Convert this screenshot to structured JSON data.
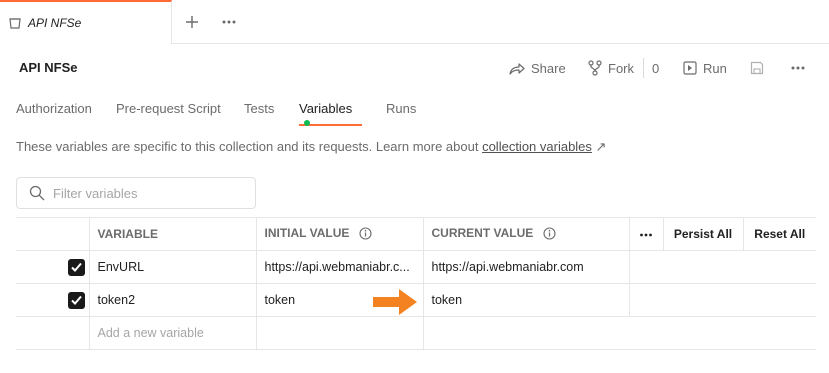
{
  "tab": {
    "title": "API NFSe"
  },
  "header": {
    "title": "API NFSe",
    "share_label": "Share",
    "fork_label": "Fork",
    "fork_count": "0",
    "run_label": "Run"
  },
  "subtabs": [
    {
      "label": "Authorization"
    },
    {
      "label": "Pre-request Script"
    },
    {
      "label": "Tests"
    },
    {
      "label": "Variables"
    },
    {
      "label": "Runs"
    }
  ],
  "description": {
    "text": "These variables are specific to this collection and its requests. Learn more about ",
    "link": "collection variables",
    "link_icon": "↗"
  },
  "filter": {
    "placeholder": "Filter variables"
  },
  "table": {
    "headers": {
      "variable": "VARIABLE",
      "initial": "INITIAL VALUE",
      "current": "CURRENT VALUE",
      "persist": "Persist All",
      "reset": "Reset All"
    },
    "rows": [
      {
        "variable": "EnvURL",
        "initial": "https://api.webmaniabr.c...",
        "current": "https://api.webmaniabr.com",
        "checked": true
      },
      {
        "variable": "token2",
        "initial": "token",
        "current": "token",
        "checked": true
      }
    ],
    "new_placeholder": "Add a new variable"
  },
  "colors": {
    "accent": "#ff6c37",
    "status_dot": "#0cbb52",
    "arrow": "#f58220"
  }
}
